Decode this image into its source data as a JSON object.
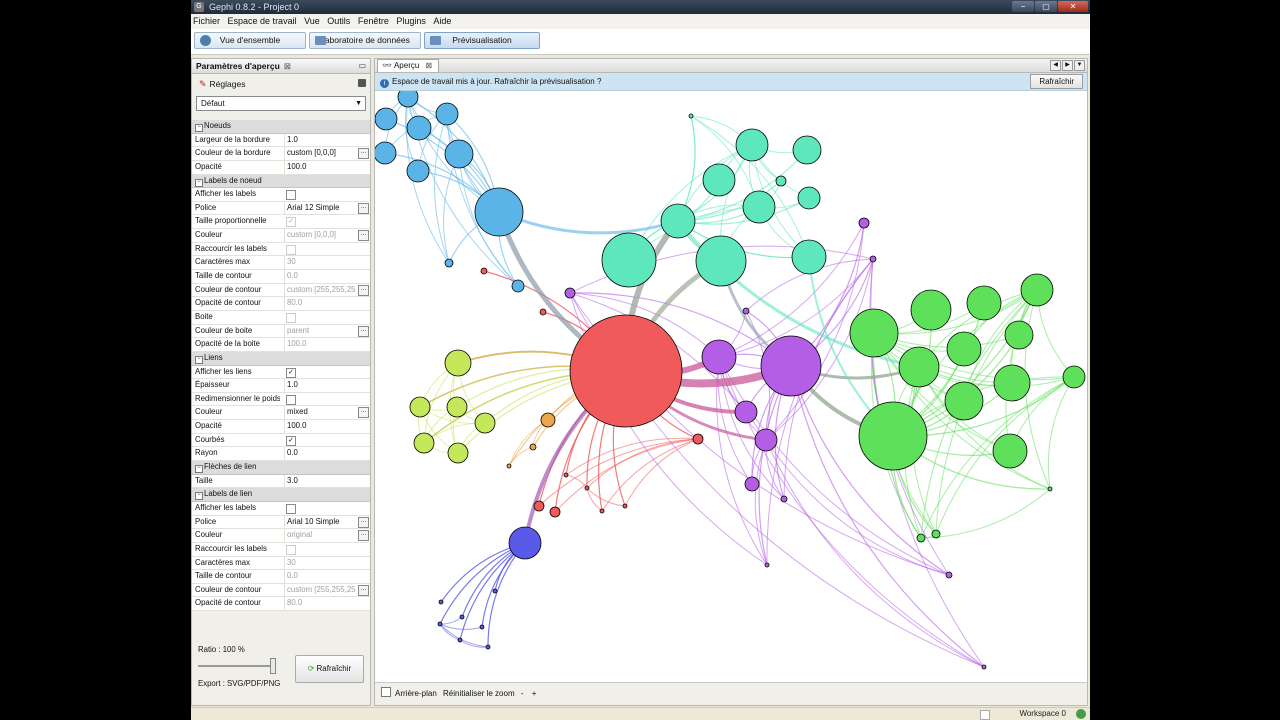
{
  "window": {
    "title": "Gephi 0.8.2 - Project 0",
    "controls": [
      "−",
      "▢",
      "✕"
    ]
  },
  "menu": [
    "Fichier",
    "Espace de travail",
    "Vue",
    "Outils",
    "Fenêtre",
    "Plugins",
    "Aide"
  ],
  "toolbar": {
    "overview": "Vue d'ensemble",
    "datalab": "Laboratoire de données",
    "preview": "Prévisualisation"
  },
  "left": {
    "title": "Paramètres d'aperçu",
    "settings_label": "Réglages",
    "preset": "Défaut",
    "sections": [
      {
        "title": "Noeuds",
        "rows": [
          {
            "key": "Largeur de la bordure",
            "value": "1.0"
          },
          {
            "key": "Couleur de la bordure",
            "value": "custom [0,0,0]",
            "more": true
          },
          {
            "key": "Opacité",
            "value": "100.0"
          }
        ]
      },
      {
        "title": "Labels de noeud",
        "rows": [
          {
            "key": "Afficher les labels",
            "check": false
          },
          {
            "key": "Police",
            "value": "Arial 12 Simple",
            "more": true
          },
          {
            "key": "Taille proportionnelle",
            "check": true,
            "disabled": true
          },
          {
            "key": "Couleur",
            "value": "custom [0,0,0]",
            "disabled": true,
            "more": true
          },
          {
            "key": "Raccourcir les labels",
            "check": false,
            "disabled": true
          },
          {
            "key": "Caractères max",
            "value": "30",
            "disabled": true
          },
          {
            "key": "Taille de contour",
            "value": "0.0",
            "disabled": true
          },
          {
            "key": "Couleur de contour",
            "value": "custom [255,255,255]",
            "disabled": true,
            "more": true
          },
          {
            "key": "Opacité de contour",
            "value": "80.0",
            "disabled": true
          },
          {
            "key": "Boite",
            "check": false,
            "disabled": true
          },
          {
            "key": "Couleur de boite",
            "value": "parent",
            "disabled": true,
            "more": true
          },
          {
            "key": "Opacité de la boite",
            "value": "100.0",
            "disabled": true
          }
        ]
      },
      {
        "title": "Liens",
        "rows": [
          {
            "key": "Afficher les liens",
            "check": true
          },
          {
            "key": "Épaisseur",
            "value": "1.0"
          },
          {
            "key": "Redimensionner le poids",
            "check": false
          },
          {
            "key": "Couleur",
            "value": "mixed",
            "more": true
          },
          {
            "key": "Opacité",
            "value": "100.0"
          },
          {
            "key": "Courbés",
            "check": true
          },
          {
            "key": "Rayon",
            "value": "0.0"
          }
        ]
      },
      {
        "title": "Flèches de lien",
        "rows": [
          {
            "key": "Taille",
            "value": "3.0"
          }
        ]
      },
      {
        "title": "Labels de lien",
        "rows": [
          {
            "key": "Afficher les labels",
            "check": false
          },
          {
            "key": "Police",
            "value": "Arial 10 Simple",
            "more": true
          },
          {
            "key": "Couleur",
            "value": "original",
            "disabled": true,
            "more": true
          },
          {
            "key": "Raccourcir les labels",
            "check": false,
            "disabled": true
          },
          {
            "key": "Caractères max",
            "value": "30",
            "disabled": true
          },
          {
            "key": "Taille de contour",
            "value": "0.0",
            "disabled": true
          },
          {
            "key": "Couleur de contour",
            "value": "custom [255,255,255]",
            "disabled": true,
            "more": true
          },
          {
            "key": "Opacité de contour",
            "value": "80.0",
            "disabled": true
          }
        ]
      }
    ],
    "ratio": "Ratio : 100 %",
    "refresh": "Rafraîchir",
    "export": "Export : SVG/PDF/PNG"
  },
  "right": {
    "tab": "Aperçu",
    "notification": "Espace de travail mis à jour. Rafraîchir la prévisualisation ?",
    "notification_button": "Rafraîchir",
    "background_label": "Arrière-plan",
    "reset_zoom": "Réinitialiser le zoom",
    "zoom_out": "-",
    "zoom_in": "+"
  },
  "status": {
    "workspace": "Workspace 0"
  },
  "graph": {
    "colors": {
      "blue": "#5ab4e8",
      "teal": "#5ee6bc",
      "green": "#5fe05a",
      "red": "#f05a5a",
      "purple": "#b45ee6",
      "yellow": "#c4e85a",
      "orange": "#eca64a",
      "indigo": "#5a5ae8"
    },
    "node_groups": {
      "blue": 12,
      "teal": 13,
      "green": 15,
      "red": 11,
      "purple": 8,
      "yellow": 7,
      "orange": 2,
      "indigo": 9
    }
  }
}
